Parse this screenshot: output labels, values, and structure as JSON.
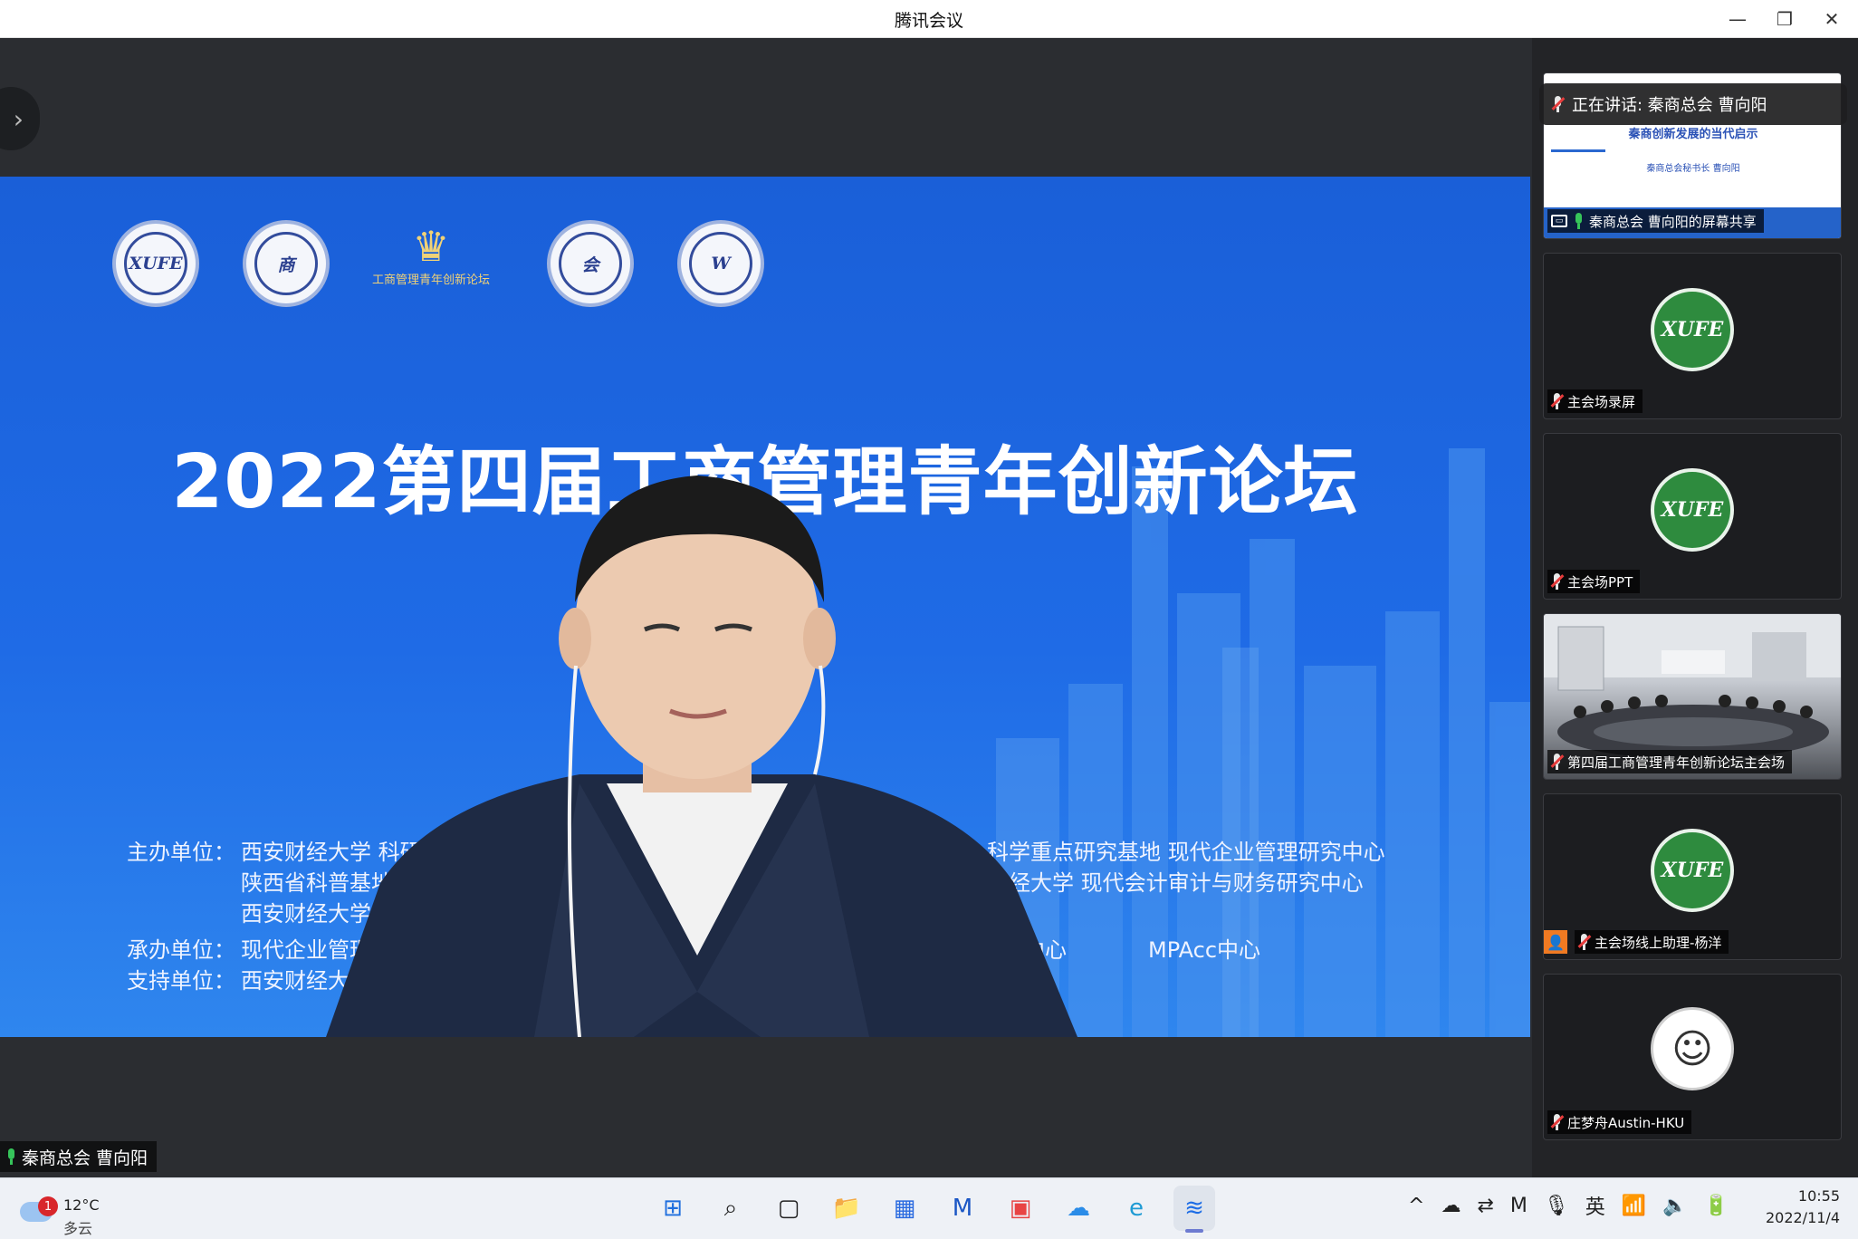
{
  "window": {
    "title": "腾讯会议",
    "controls": {
      "minimize": "—",
      "restore": "❐",
      "close": "✕"
    }
  },
  "slide": {
    "logos": [
      "XUFE",
      "商",
      "会",
      "W"
    ],
    "forum_logo_text": "工商管理青年创新论坛",
    "title": "2022第四届工商管理青年创新论坛",
    "host_label": "主办单位：",
    "host_lines": [
      "西安财经大学 科研",
      "陕西省科普基地",
      "西安财经大学"
    ],
    "host_right_lines": [
      "科学重点研究基地 现代企业管理研究中心",
      "财经大学 现代会计审计与财务研究中心"
    ],
    "organizer_label": "承办单位：",
    "organizer_text": "现代企业管理",
    "organizer_right": "中心",
    "organizer_mpacc": "MPAcc中心",
    "support_label": "支持单位：",
    "support_text": "西安财经大"
  },
  "speaker": {
    "name": "秦商总会  曹向阳"
  },
  "talking": {
    "text": "正在讲话: 秦商总会  曹向阳"
  },
  "participants": [
    {
      "name": "秦商总会  曹向阳的屏幕共享",
      "type": "share",
      "preview_title": "秦商创新发展的当代启示",
      "preview_sub": "秦商总会秘书长  曹向阳"
    },
    {
      "name": "主会场录屏",
      "type": "logo",
      "logo": "XUFE"
    },
    {
      "name": "主会场PPT",
      "type": "logo",
      "logo": "XUFE"
    },
    {
      "name": "第四届工商管理青年创新论坛主会场",
      "type": "room"
    },
    {
      "name": "主会场线上助理-杨洋",
      "type": "logo",
      "logo": "XUFE"
    },
    {
      "name": "庄梦舟Austin-HKU",
      "type": "avatar",
      "avatar": "☺"
    }
  ],
  "taskbar": {
    "weather": {
      "badge": "1",
      "temp": "12°C",
      "condition": "多云"
    },
    "apps": [
      {
        "name": "start",
        "glyph": "⊞",
        "color": "#1f6fde"
      },
      {
        "name": "search",
        "glyph": "⌕",
        "color": "#222"
      },
      {
        "name": "task-view",
        "glyph": "▢",
        "color": "#222"
      },
      {
        "name": "file-explorer",
        "glyph": "📁",
        "color": "#e8b230"
      },
      {
        "name": "store",
        "glyph": "▦",
        "color": "#2b6be0"
      },
      {
        "name": "mail",
        "glyph": "M",
        "color": "#1a56c5"
      },
      {
        "name": "huawei-app",
        "glyph": "▣",
        "color": "#e84444"
      },
      {
        "name": "cloud-app",
        "glyph": "☁",
        "color": "#2a8ce8"
      },
      {
        "name": "edge",
        "glyph": "e",
        "color": "#1f9bd4"
      },
      {
        "name": "tencent-meeting",
        "glyph": "≋",
        "color": "#1d6de6"
      }
    ],
    "tray": [
      "^",
      "☁",
      "⇄",
      "M",
      "🎙",
      "英",
      "📶",
      "🔈",
      "🔋"
    ],
    "time": "10:55",
    "date": "2022/11/4"
  }
}
